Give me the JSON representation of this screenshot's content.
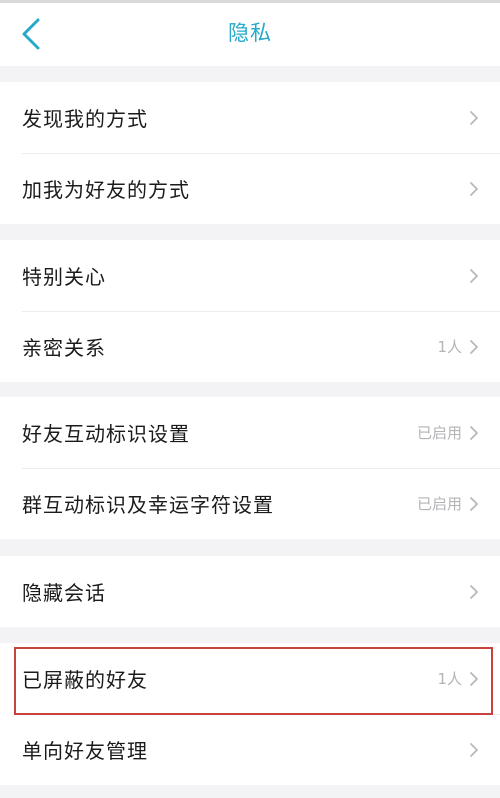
{
  "header": {
    "title": "隐私"
  },
  "groups": [
    {
      "items": [
        {
          "label": "发现我的方式",
          "value": ""
        },
        {
          "label": "加我为好友的方式",
          "value": ""
        }
      ]
    },
    {
      "items": [
        {
          "label": "特别关心",
          "value": ""
        },
        {
          "label": "亲密关系",
          "value": "1人"
        }
      ]
    },
    {
      "items": [
        {
          "label": "好友互动标识设置",
          "value": "已启用"
        },
        {
          "label": "群互动标识及幸运字符设置",
          "value": "已启用"
        }
      ]
    },
    {
      "items": [
        {
          "label": "隐藏会话",
          "value": ""
        }
      ]
    },
    {
      "items": [
        {
          "label": "已屏蔽的好友",
          "value": "1人",
          "highlighted": true
        },
        {
          "label": "单向好友管理",
          "value": ""
        }
      ]
    }
  ],
  "colors": {
    "accent": "#27a9c9",
    "background": "#f3f3f5",
    "highlight_border": "#c9413b",
    "secondary_text": "#b4b4b8"
  },
  "icons": {
    "back": "chevron-left-icon",
    "row_arrow": "chevron-right-icon"
  }
}
